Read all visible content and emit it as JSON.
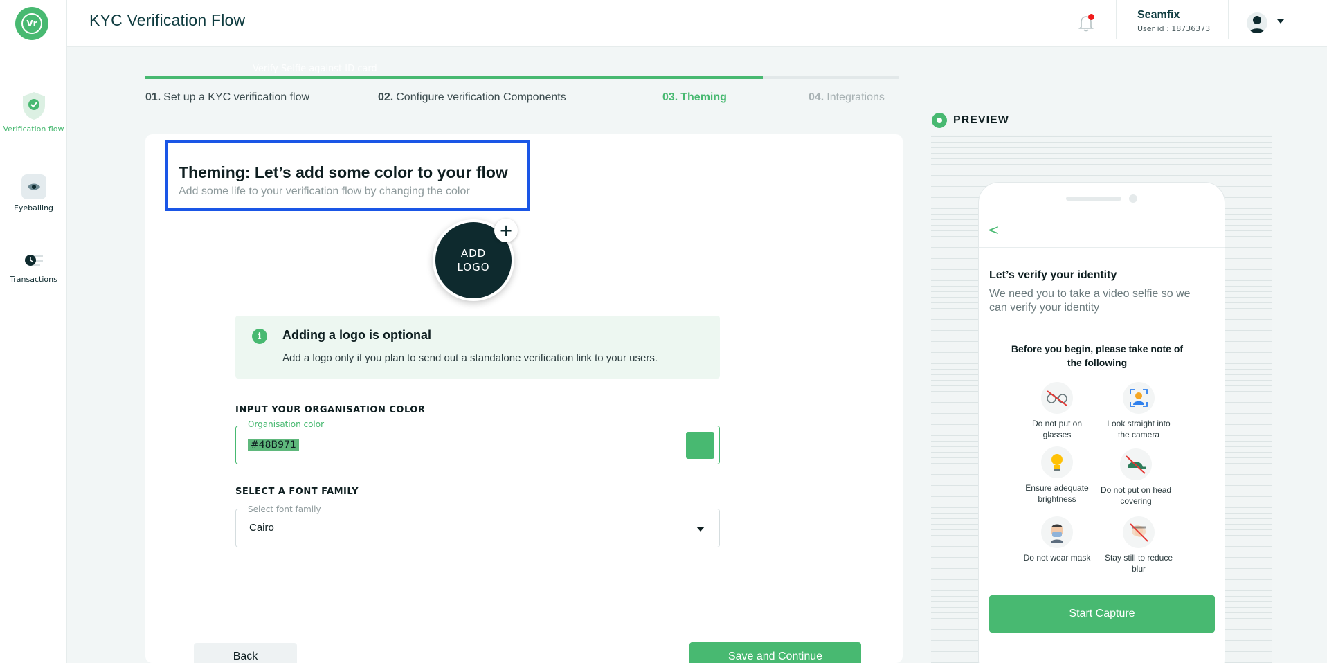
{
  "app": {
    "brand_text": "Vr",
    "page_title": "KYC Verification Flow"
  },
  "sidebar": {
    "items": [
      {
        "label": "Verification flow",
        "icon": "shield-check-icon",
        "active": true
      },
      {
        "label": "Eyeballing",
        "icon": "eye-icon",
        "active": false
      },
      {
        "label": "Transactions",
        "icon": "transactions-icon",
        "active": false
      }
    ]
  },
  "header": {
    "user_name": "Seamfix",
    "user_id": "User id : 18736373",
    "notification_icon": "bell-icon",
    "avatar_icon": "user-avatar-icon"
  },
  "stepper": {
    "progress": 0.82,
    "ghost_text": "Verify Selfie against ID card",
    "steps": [
      {
        "num": "01.",
        "label": "Set up a KYC verification flow",
        "state": "done"
      },
      {
        "num": "02.",
        "label": "Configure verification Components",
        "state": "done"
      },
      {
        "num": "03.",
        "label": "Theming",
        "state": "current"
      },
      {
        "num": "04.",
        "label": "Integrations",
        "state": "upcoming"
      }
    ]
  },
  "theming": {
    "title": "Theming: Let’s add some color to your flow",
    "subtitle": "Add some life to your verification flow by changing the color",
    "logo_line1": "ADD",
    "logo_line2": "LOGO",
    "plus": "+",
    "info_icon": "i",
    "info_title": "Adding a logo is optional",
    "info_text": "Add a logo only if you plan to send out  a standalone verification link to your users.",
    "color_section": "INPUT YOUR ORGANISATION COLOR",
    "color_legend": "Organisation color",
    "color_value": "#48B971",
    "font_section": "SELECT A FONT FAMILY",
    "font_legend": "Select font family",
    "font_value": "Cairo",
    "back_label": "Back",
    "save_label": "Save and Continue"
  },
  "preview": {
    "label": "PREVIEW",
    "back": "<",
    "title": "Let’s verify your identity",
    "subtitle": "We need you to take a video selfie so we can verify your identity",
    "note": "Before you begin, please take note of the following",
    "tips": [
      {
        "label": "Do not put on glasses",
        "icon": "no-glasses-icon"
      },
      {
        "label": "Look straight into the camera",
        "icon": "face-camera-icon"
      },
      {
        "label": "Ensure adequate brightness",
        "icon": "lightbulb-icon"
      },
      {
        "label": "Do not put on head covering",
        "icon": "no-cap-icon"
      },
      {
        "label": "Do not wear mask",
        "icon": "mask-face-icon"
      },
      {
        "label": "Stay still to reduce blur",
        "icon": "no-blur-icon"
      }
    ],
    "start_label": "Start Capture"
  },
  "colors": {
    "accent": "#48B971",
    "dark": "#0E2A2E",
    "highlight_border": "#1A56E6",
    "notification": "#F01C1C"
  }
}
